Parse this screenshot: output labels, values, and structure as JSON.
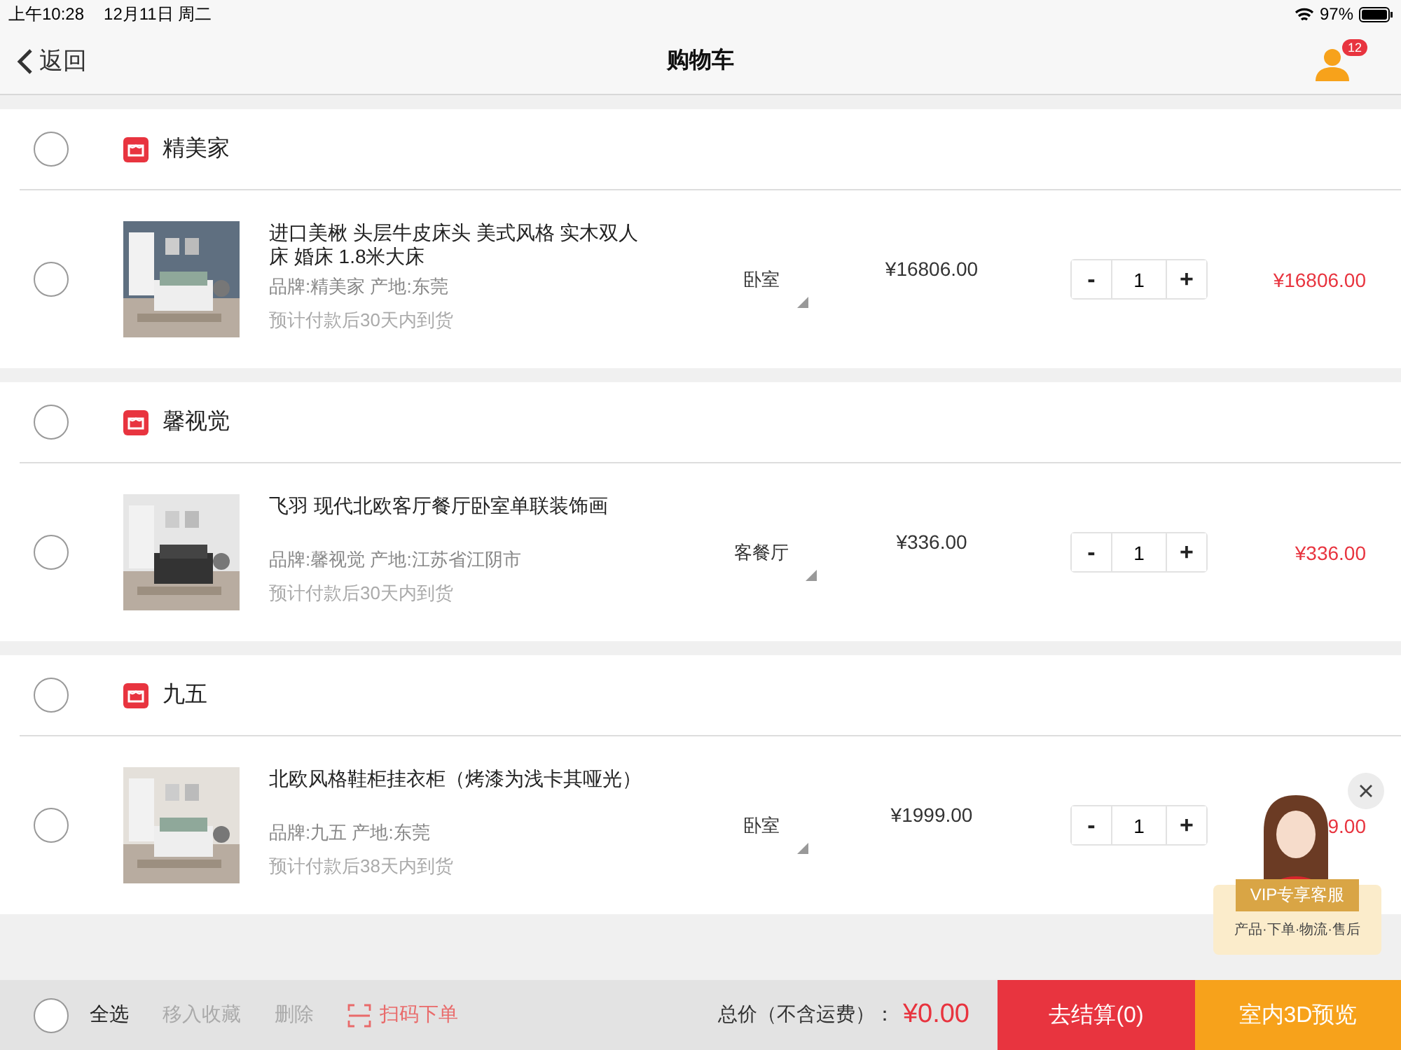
{
  "status_bar": {
    "time": "上午10:28",
    "date": "12月11日 周二",
    "battery": "97%"
  },
  "nav": {
    "back": "返回",
    "title": "购物车",
    "badge": "12"
  },
  "stores": [
    {
      "name": "精美家",
      "selected": false,
      "items": [
        {
          "title": "进口美楸 头层牛皮床头 美式风格 实木双人床 婚床 1.8米大床",
          "brand_origin": "品牌:精美家 产地:东莞",
          "delivery": "预计付款后30天内到货",
          "category": "卧室",
          "price": "¥16806.00",
          "decrease": "-",
          "quantity": "1",
          "increase": "+",
          "total": "¥16806.00",
          "selected": false
        }
      ]
    },
    {
      "name": "馨视觉",
      "selected": false,
      "items": [
        {
          "title": "飞羽 现代北欧客厅餐厅卧室单联装饰画",
          "brand_origin": "品牌:馨视觉 产地:江苏省江阴市",
          "delivery": "预计付款后30天内到货",
          "category": "客餐厅",
          "price": "¥336.00",
          "decrease": "-",
          "quantity": "1",
          "increase": "+",
          "total": "¥336.00",
          "selected": false
        }
      ]
    },
    {
      "name": "九五",
      "selected": false,
      "items": [
        {
          "title": "北欧风格鞋柜挂衣柜（烤漆为浅卡其哑光）",
          "brand_origin": "品牌:九五 产地:东莞",
          "delivery": "预计付款后38天内到货",
          "category": "卧室",
          "price": "¥1999.00",
          "decrease": "-",
          "quantity": "1",
          "increase": "+",
          "total": "9.00",
          "selected": false
        }
      ]
    }
  ],
  "service_widget": {
    "title": "VIP专享客服",
    "subtitle": "产品·下单·物流·售后"
  },
  "bottom_bar": {
    "select_all": {
      "label": "全选",
      "selected": false
    },
    "actions": [
      {
        "kind": "plain",
        "label": "移入收藏",
        "disabled": true
      },
      {
        "kind": "plain",
        "label": "删除",
        "disabled": true
      },
      {
        "kind": "scan",
        "label": "扫码下单",
        "disabled": false
      }
    ],
    "total_label": "总价（不含运费）：",
    "total": "¥0.00",
    "checkout": "去结算(0)",
    "preview": "室内3D预览"
  }
}
